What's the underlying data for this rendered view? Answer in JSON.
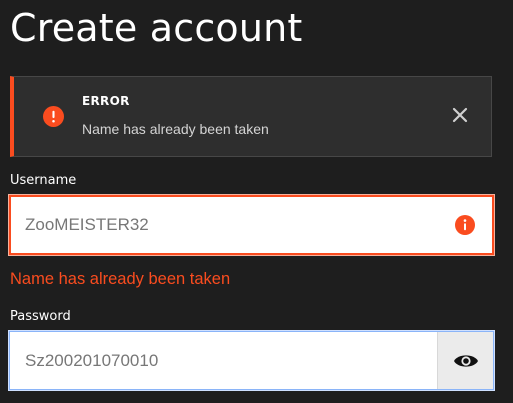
{
  "page": {
    "title": "Create account"
  },
  "alert": {
    "type": "error",
    "title": "ERROR",
    "message": "Name has already been taken",
    "icon": "alert-circle-icon",
    "close_icon": "close-icon"
  },
  "form": {
    "username": {
      "label": "Username",
      "value": "ZooMEISTER32",
      "error": "Name has already been taken",
      "error_icon": "info-icon"
    },
    "password": {
      "label": "Password",
      "value": "Sz200201070010",
      "toggle_icon": "eye-icon"
    }
  },
  "colors": {
    "background": "#1e1e1e",
    "alert_background": "#2e2e2e",
    "error": "#fa4c1f",
    "focus": "#8ab4f8",
    "input_background": "#ffffff",
    "toggle_background": "#ebebeb"
  }
}
